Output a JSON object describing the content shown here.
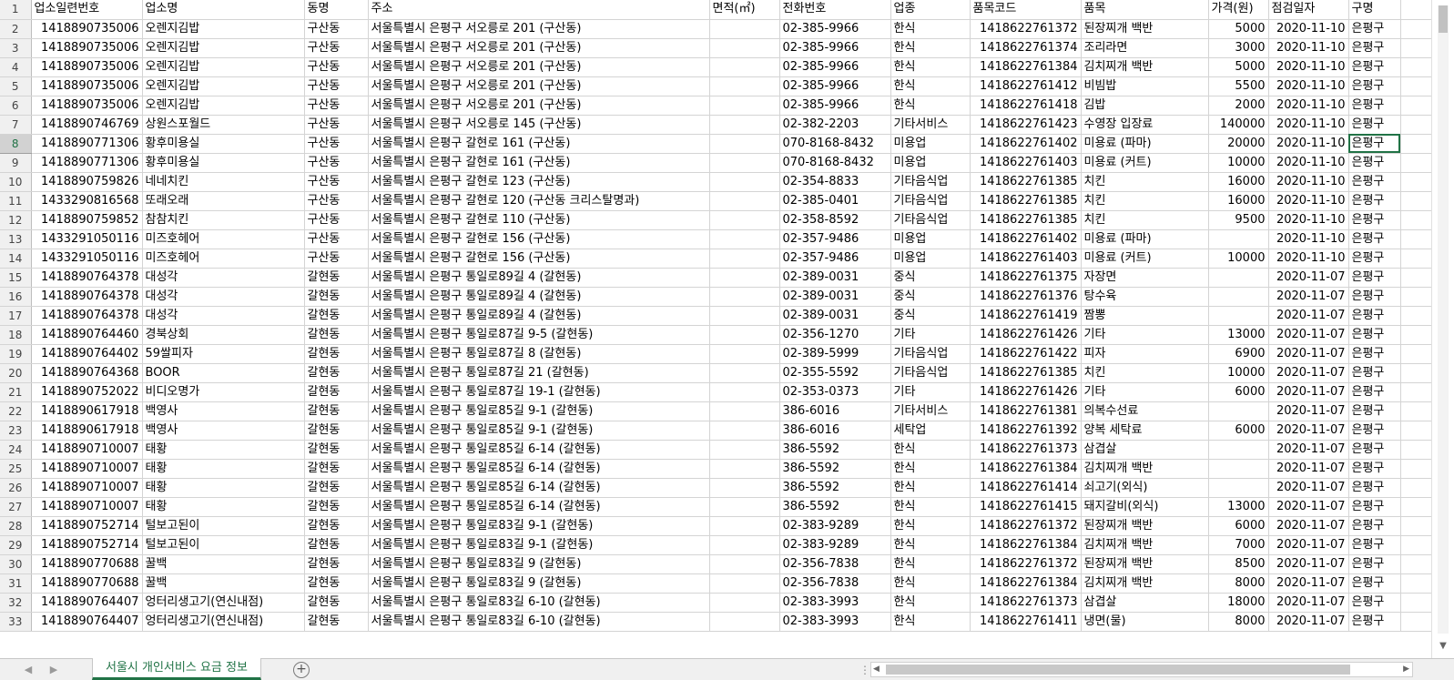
{
  "sheet": {
    "tab_label": "서울시 개인서비스 요금 정보",
    "headers": [
      "업소일련번호",
      "업소명",
      "동명",
      "주소",
      "면적(㎡)",
      "전화번호",
      "업종",
      "품목코드",
      "품목",
      "가격(원)",
      "점검일자",
      "구명"
    ],
    "rows": [
      [
        "1418890735006",
        "오렌지김밥",
        "구산동",
        "서울특별시 은평구 서오릉로 201 (구산동)",
        "",
        "02-385-9966",
        "한식",
        "1418622761372",
        "된장찌개 백반",
        "5000",
        "2020-11-10",
        "은평구"
      ],
      [
        "1418890735006",
        "오렌지김밥",
        "구산동",
        "서울특별시 은평구 서오릉로 201 (구산동)",
        "",
        "02-385-9966",
        "한식",
        "1418622761374",
        "조리라면",
        "3000",
        "2020-11-10",
        "은평구"
      ],
      [
        "1418890735006",
        "오렌지김밥",
        "구산동",
        "서울특별시 은평구 서오릉로 201 (구산동)",
        "",
        "02-385-9966",
        "한식",
        "1418622761384",
        "김치찌개 백반",
        "5000",
        "2020-11-10",
        "은평구"
      ],
      [
        "1418890735006",
        "오렌지김밥",
        "구산동",
        "서울특별시 은평구 서오릉로 201 (구산동)",
        "",
        "02-385-9966",
        "한식",
        "1418622761412",
        "비빔밥",
        "5500",
        "2020-11-10",
        "은평구"
      ],
      [
        "1418890735006",
        "오렌지김밥",
        "구산동",
        "서울특별시 은평구 서오릉로 201 (구산동)",
        "",
        "02-385-9966",
        "한식",
        "1418622761418",
        "김밥",
        "2000",
        "2020-11-10",
        "은평구"
      ],
      [
        "1418890746769",
        "상원스포월드",
        "구산동",
        "서울특별시 은평구 서오릉로 145 (구산동)",
        "",
        "02-382-2203",
        "기타서비스",
        "1418622761423",
        "수영장 입장료",
        "140000",
        "2020-11-10",
        "은평구"
      ],
      [
        "1418890771306",
        "황후미용실",
        "구산동",
        "서울특별시 은평구 갈현로 161 (구산동)",
        "",
        "070-8168-8432",
        "미용업",
        "1418622761402",
        "미용료 (파마)",
        "20000",
        "2020-11-10",
        "은평구"
      ],
      [
        "1418890771306",
        "황후미용실",
        "구산동",
        "서울특별시 은평구 갈현로 161 (구산동)",
        "",
        "070-8168-8432",
        "미용업",
        "1418622761403",
        "미용료 (커트)",
        "10000",
        "2020-11-10",
        "은평구"
      ],
      [
        "1418890759826",
        "네네치킨",
        "구산동",
        "서울특별시 은평구 갈현로 123 (구산동)",
        "",
        "02-354-8833",
        "기타음식업",
        "1418622761385",
        "치킨",
        "16000",
        "2020-11-10",
        "은평구"
      ],
      [
        "1433290816568",
        "또래오래",
        "구산동",
        "서울특별시 은평구 갈현로 120 (구산동 크리스탈명과)",
        "",
        "02-385-0401",
        "기타음식업",
        "1418622761385",
        "치킨",
        "16000",
        "2020-11-10",
        "은평구"
      ],
      [
        "1418890759852",
        "참참치킨",
        "구산동",
        "서울특별시 은평구 갈현로 110 (구산동)",
        "",
        "02-358-8592",
        "기타음식업",
        "1418622761385",
        "치킨",
        "9500",
        "2020-11-10",
        "은평구"
      ],
      [
        "1433291050116",
        "미즈호헤어",
        "구산동",
        "서울특별시 은평구 갈현로 156 (구산동)",
        "",
        "02-357-9486",
        "미용업",
        "1418622761402",
        "미용료 (파마)",
        "",
        "2020-11-10",
        "은평구"
      ],
      [
        "1433291050116",
        "미즈호헤어",
        "구산동",
        "서울특별시 은평구 갈현로 156 (구산동)",
        "",
        "02-357-9486",
        "미용업",
        "1418622761403",
        "미용료 (커트)",
        "10000",
        "2020-11-10",
        "은평구"
      ],
      [
        "1418890764378",
        "대성각",
        "갈현동",
        "서울특별시 은평구 통일로89길 4 (갈현동)",
        "",
        "02-389-0031",
        "중식",
        "1418622761375",
        "자장면",
        "",
        "2020-11-07",
        "은평구"
      ],
      [
        "1418890764378",
        "대성각",
        "갈현동",
        "서울특별시 은평구 통일로89길 4 (갈현동)",
        "",
        "02-389-0031",
        "중식",
        "1418622761376",
        "탕수육",
        "",
        "2020-11-07",
        "은평구"
      ],
      [
        "1418890764378",
        "대성각",
        "갈현동",
        "서울특별시 은평구 통일로89길 4 (갈현동)",
        "",
        "02-389-0031",
        "중식",
        "1418622761419",
        "짬뽕",
        "",
        "2020-11-07",
        "은평구"
      ],
      [
        "1418890764460",
        "경북상회",
        "갈현동",
        "서울특별시 은평구 통일로87길 9-5 (갈현동)",
        "",
        "02-356-1270",
        "기타",
        "1418622761426",
        "기타",
        "13000",
        "2020-11-07",
        "은평구"
      ],
      [
        "1418890764402",
        "59쌀피자",
        "갈현동",
        "서울특별시 은평구 통일로87길 8 (갈현동)",
        "",
        "02-389-5999",
        "기타음식업",
        "1418622761422",
        "피자",
        "6900",
        "2020-11-07",
        "은평구"
      ],
      [
        "1418890764368",
        "BOOR",
        "갈현동",
        "서울특별시 은평구 통일로87길 21 (갈현동)",
        "",
        "02-355-5592",
        "기타음식업",
        "1418622761385",
        "치킨",
        "10000",
        "2020-11-07",
        "은평구"
      ],
      [
        "1418890752022",
        "비디오명가",
        "갈현동",
        "서울특별시 은평구 통일로87길 19-1 (갈현동)",
        "",
        "02-353-0373",
        "기타",
        "1418622761426",
        "기타",
        "6000",
        "2020-11-07",
        "은평구"
      ],
      [
        "1418890617918",
        "백영사",
        "갈현동",
        "서울특별시 은평구 통일로85길 9-1 (갈현동)",
        "",
        "386-6016",
        "기타서비스",
        "1418622761381",
        "의복수선료",
        "",
        "2020-11-07",
        "은평구"
      ],
      [
        "1418890617918",
        "백영사",
        "갈현동",
        "서울특별시 은평구 통일로85길 9-1 (갈현동)",
        "",
        "386-6016",
        "세탁업",
        "1418622761392",
        "양복 세탁료",
        "6000",
        "2020-11-07",
        "은평구"
      ],
      [
        "1418890710007",
        "태황",
        "갈현동",
        "서울특별시 은평구 통일로85길 6-14 (갈현동)",
        "",
        "386-5592",
        "한식",
        "1418622761373",
        "삼겹살",
        "",
        "2020-11-07",
        "은평구"
      ],
      [
        "1418890710007",
        "태황",
        "갈현동",
        "서울특별시 은평구 통일로85길 6-14 (갈현동)",
        "",
        "386-5592",
        "한식",
        "1418622761384",
        "김치찌개 백반",
        "",
        "2020-11-07",
        "은평구"
      ],
      [
        "1418890710007",
        "태황",
        "갈현동",
        "서울특별시 은평구 통일로85길 6-14 (갈현동)",
        "",
        "386-5592",
        "한식",
        "1418622761414",
        "쇠고기(외식)",
        "",
        "2020-11-07",
        "은평구"
      ],
      [
        "1418890710007",
        "태황",
        "갈현동",
        "서울특별시 은평구 통일로85길 6-14 (갈현동)",
        "",
        "386-5592",
        "한식",
        "1418622761415",
        "돼지갈비(외식)",
        "13000",
        "2020-11-07",
        "은평구"
      ],
      [
        "1418890752714",
        "털보고된이",
        "갈현동",
        "서울특별시 은평구 통일로83길 9-1 (갈현동)",
        "",
        "02-383-9289",
        "한식",
        "1418622761372",
        "된장찌개 백반",
        "6000",
        "2020-11-07",
        "은평구"
      ],
      [
        "1418890752714",
        "털보고된이",
        "갈현동",
        "서울특별시 은평구 통일로83길 9-1 (갈현동)",
        "",
        "02-383-9289",
        "한식",
        "1418622761384",
        "김치찌개 백반",
        "7000",
        "2020-11-07",
        "은평구"
      ],
      [
        "1418890770688",
        "꿀백",
        "갈현동",
        "서울특별시 은평구 통일로83길 9 (갈현동)",
        "",
        "02-356-7838",
        "한식",
        "1418622761372",
        "된장찌개 백반",
        "8500",
        "2020-11-07",
        "은평구"
      ],
      [
        "1418890770688",
        "꿀백",
        "갈현동",
        "서울특별시 은평구 통일로83길 9 (갈현동)",
        "",
        "02-356-7838",
        "한식",
        "1418622761384",
        "김치찌개 백반",
        "8000",
        "2020-11-07",
        "은평구"
      ],
      [
        "1418890764407",
        "엉터리생고기(연신내점)",
        "갈현동",
        "서울특별시 은평구 통일로83길 6-10 (갈현동)",
        "",
        "02-383-3993",
        "한식",
        "1418622761373",
        "삼겹살",
        "18000",
        "2020-11-07",
        "은평구"
      ],
      [
        "1418890764407",
        "엉터리생고기(연신내점)",
        "갈현동",
        "서울특별시 은평구 통일로83길 6-10 (갈현동)",
        "",
        "02-383-3993",
        "한식",
        "1418622761411",
        "냉면(물)",
        "8000",
        "2020-11-07",
        "은평구"
      ]
    ],
    "selected_row": 8,
    "active_col": 11
  },
  "colors": {
    "accent": "#217346",
    "grid": "#d4d4d4",
    "header_bg": "#f0f0f0"
  },
  "icons": {
    "nav_prev": "caret-left-icon",
    "nav_next": "caret-right-icon",
    "add_sheet": "plus-circle-icon"
  }
}
